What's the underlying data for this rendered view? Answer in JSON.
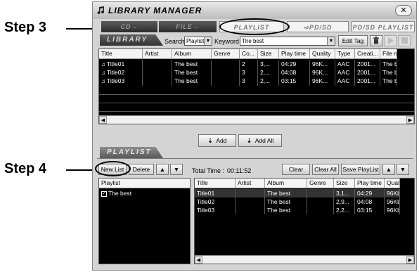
{
  "callouts": {
    "step3": "Step 3",
    "step4": "Step 4"
  },
  "window": {
    "title": "LIBRARY MANAGER",
    "close": "✕"
  },
  "tabs": [
    "CD→",
    "FILE→",
    "PLAYLIST",
    "⇨PD/SD",
    "PD/SD PLAYLIST"
  ],
  "library": {
    "label": "LIBRARY",
    "search_label": "Search",
    "search_value": "Playlist",
    "keyword_label": "Keyword",
    "keyword_value": "The best",
    "edit_tag": "Edit Tag",
    "columns": [
      "Title",
      "Artist",
      "Album",
      "Genre",
      "Co...",
      "Size",
      "Play time",
      "Quality",
      "Type",
      "Creati...",
      "File n"
    ],
    "rows": [
      [
        "Title01",
        "",
        "The best",
        "",
        "2",
        "3,...",
        "04:29",
        "96K...",
        "AAC",
        "2001...",
        "The b"
      ],
      [
        "Title02",
        "",
        "The best",
        "",
        "3",
        "2,...",
        "04:08",
        "96K...",
        "AAC",
        "2001...",
        "The b"
      ],
      [
        "Title03",
        "",
        "The best",
        "",
        "3",
        "2,...",
        "03:15",
        "96K...",
        "AAC",
        "2001...",
        "The b"
      ]
    ]
  },
  "middle": {
    "add": "Add",
    "add_all": "Add All"
  },
  "playlist": {
    "label": "PLAYLIST",
    "new_list": "New List",
    "delete": "Delete",
    "total_time_label": "Total Time :",
    "total_time_value": "00:11:52",
    "clear": "Clear",
    "clear_all": "Clear All",
    "save_playlist": "Save PlayList",
    "list_header": "Playlist",
    "lists": [
      {
        "name": "The best",
        "checked": true
      }
    ],
    "columns": [
      "Title",
      "Artist",
      "Album",
      "Genre",
      "Size",
      "Play time",
      "Quali"
    ],
    "rows": [
      [
        "Title01",
        "",
        "The best",
        "",
        "3,1...",
        "04:29",
        "96Kb"
      ],
      [
        "Title02",
        "",
        "The best",
        "",
        "2,9...",
        "04:08",
        "96Kb"
      ],
      [
        "Title03",
        "",
        "The best",
        "",
        "2,2...",
        "03:15",
        "96Kb"
      ]
    ]
  },
  "icons": {
    "window": "music-note-icon",
    "trash": "trash-icon",
    "up": "arrow-up-icon",
    "down": "arrow-down-icon",
    "play": "play-icon",
    "stop": "stop-icon"
  }
}
